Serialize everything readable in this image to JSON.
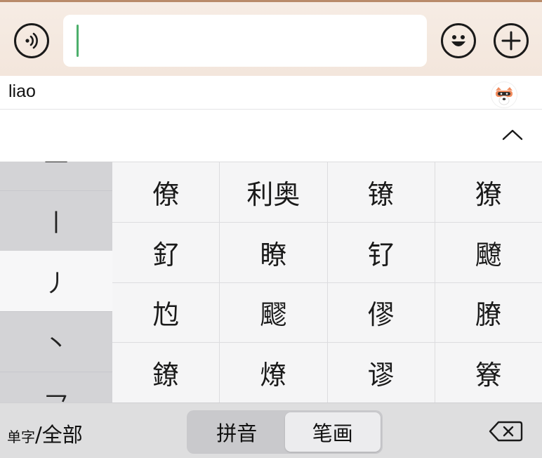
{
  "input_bar": {
    "voice_icon": "voice-wave-icon",
    "text_value": "",
    "emoji_icon": "smiley-icon",
    "plus_icon": "plus-icon"
  },
  "composition": {
    "pinyin": "liao",
    "assistant_icon": "bot-avatar-icon"
  },
  "candidate_bar": {
    "expand_icon": "chevron-up-icon"
  },
  "stroke_filter": [
    "一",
    "丨",
    "丿",
    "丶",
    "乛"
  ],
  "candidates": [
    "僚",
    "利奥",
    "镣",
    "獠",
    "釕",
    "瞭",
    "钌",
    "飉",
    "尥",
    "飂",
    "僇",
    "膫",
    "鐐",
    "燎",
    "谬",
    "簝"
  ],
  "bottom_bar": {
    "scope_single": "单字",
    "scope_sep": "/",
    "scope_all": "全部",
    "mode_pinyin": "拼音",
    "mode_stroke": "笔画",
    "active_mode": "笔画",
    "backspace_icon": "backspace-icon"
  },
  "colors": {
    "caret": "#4caf6b",
    "accent_top": "#b98b6a"
  }
}
